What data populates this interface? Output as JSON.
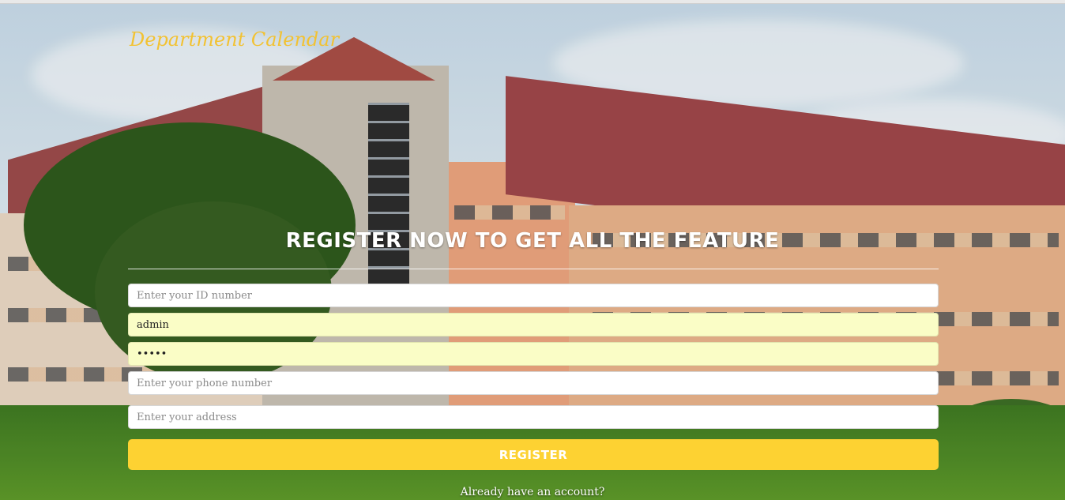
{
  "brand": {
    "title": "Department Calendar"
  },
  "form": {
    "headline": "REGISTER NOW TO GET ALL THE FEATURE",
    "id_field": {
      "placeholder": "Enter your ID number",
      "value": ""
    },
    "username_field": {
      "value": "admin"
    },
    "password_field": {
      "value": "•••••"
    },
    "phone_field": {
      "placeholder": "Enter your phone number",
      "value": ""
    },
    "address_field": {
      "placeholder": "Enter your address",
      "value": ""
    },
    "register_label": "REGISTER",
    "login_link": "Already have an account?"
  },
  "colors": {
    "accent": "#fdd232",
    "brand": "#f2c232",
    "autofill": "#fafdc6"
  }
}
